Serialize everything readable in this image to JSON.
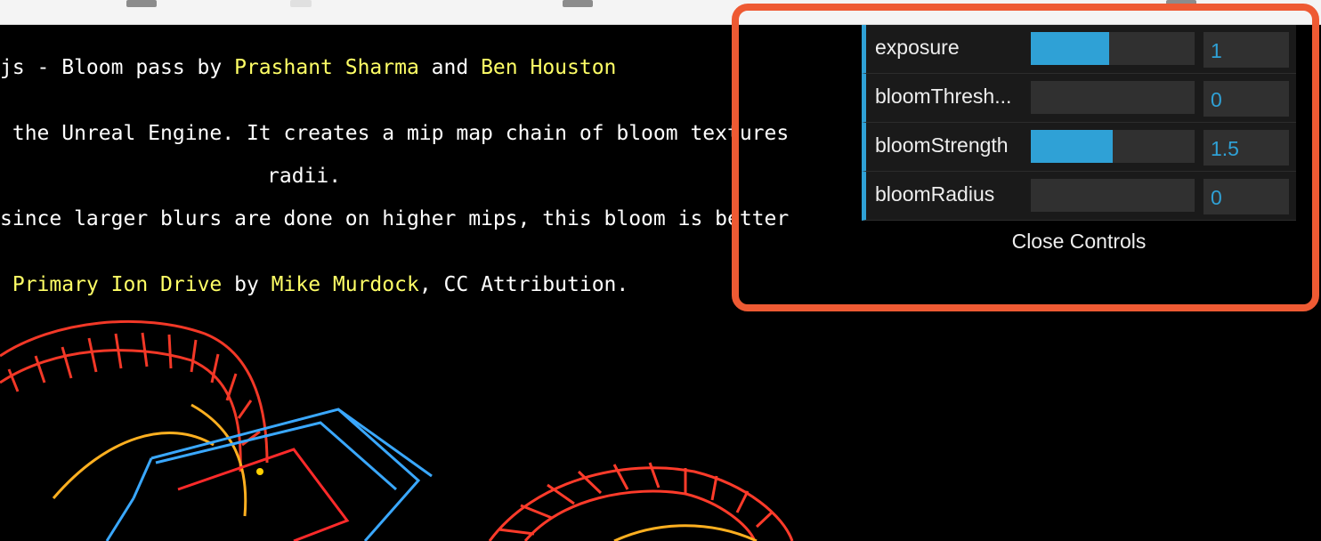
{
  "info": {
    "line1": {
      "prefix": "js - Bloom pass by ",
      "author1": "Prashant Sharma",
      "middle": " and ",
      "author2": "Ben Houston"
    },
    "line2": " the Unreal Engine. It creates a mip map chain of bloom textures",
    "line3": "radii.",
    "line4": "since larger blurs are done on higher mips, this bloom is better",
    "line5": {
      "model": "Primary Ion Drive",
      "by": " by ",
      "artist": "Mike Murdock",
      "suffix": ", CC Attribution."
    }
  },
  "gui": {
    "rows": [
      {
        "label": "exposure",
        "value": "1",
        "fraction": 0.48
      },
      {
        "label": "bloomThresh...",
        "value": "0",
        "fraction": 0.0
      },
      {
        "label": "bloomStrength",
        "value": "1.5",
        "fraction": 0.5
      },
      {
        "label": "bloomRadius",
        "value": "0",
        "fraction": 0.0
      }
    ],
    "close_label": "Close Controls"
  },
  "colors": {
    "accent": "#2fa1d6",
    "highlight": "#ee5a33",
    "link": "#ffff66"
  }
}
